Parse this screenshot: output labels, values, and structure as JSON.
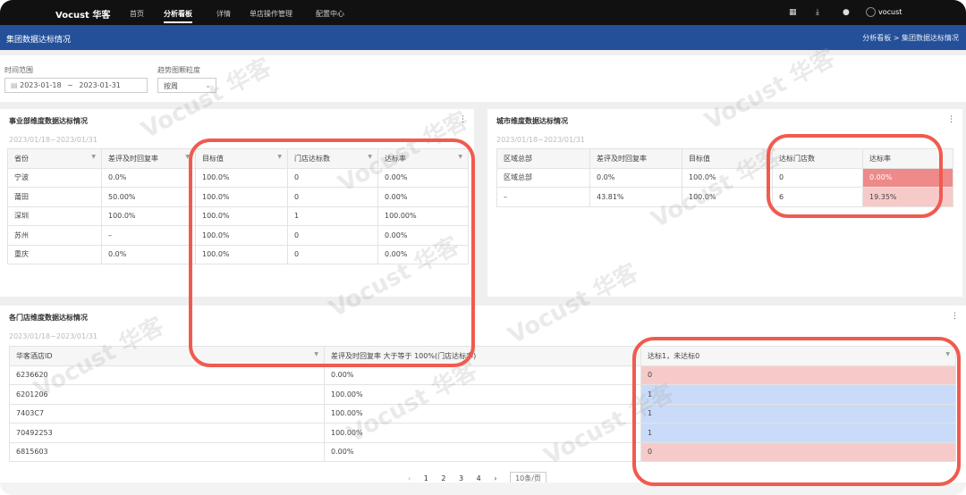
{
  "nav": {
    "brand": "Vocust 华客",
    "items": [
      "首页",
      "分析看板",
      "详情",
      "单店操作管理",
      "配置中心"
    ],
    "active": "分析看板",
    "user": "vocust",
    "icons": [
      "grid-icon",
      "download-icon",
      "help-icon"
    ]
  },
  "banner": {
    "title": "集团数据达标情况",
    "breadcrumb": "分析看板 > 集团数据达标情况"
  },
  "filters": {
    "time_label": "时间范围",
    "date_start": "2023-01-18",
    "date_sep": "~",
    "date_end": "2023-01-31",
    "granularity_label": "趋势图颗粒度",
    "granularity_value": "按周"
  },
  "card1": {
    "title": "事业部维度数据达标情况",
    "menu": "⋮",
    "date": "2023/01/18~2023/01/31",
    "headers": [
      "省份",
      "差评及时回复率",
      "目标值",
      "门店达标数",
      "达标率"
    ],
    "rows": [
      [
        "宁波",
        "0.0%",
        "100.0%",
        "0",
        "0.00%"
      ],
      [
        "莆田",
        "50.00%",
        "100.0%",
        "0",
        "0.00%"
      ],
      [
        "深圳",
        "100.0%",
        "100.0%",
        "1",
        "100.00%"
      ],
      [
        "苏州",
        "–",
        "100.0%",
        "0",
        "0.00%"
      ],
      [
        "重庆",
        "0.0%",
        "100.0%",
        "0",
        "0.00%"
      ]
    ]
  },
  "card2": {
    "title": "城市维度数据达标情况",
    "menu": "⋮",
    "date": "2023/01/18~2023/01/31",
    "headers": [
      "区域总部",
      "差评及时回复率",
      "目标值",
      "达标门店数",
      "达标率"
    ],
    "rows": [
      [
        "区域总部",
        "0.0%",
        "100.0%",
        "0",
        "0.00%"
      ],
      [
        "–",
        "43.81%",
        "100.0%",
        "6",
        "19.35%"
      ]
    ]
  },
  "card3": {
    "title": "各门店维度数据达标情况",
    "menu": "⋮",
    "date": "2023/01/18~2023/01/31",
    "headers": [
      "华客酒店ID",
      "差评及时回复率 大于等于 100%(门店达标率)",
      "达标1，未达标0"
    ],
    "rows": [
      [
        "6236620",
        "0.00%",
        "0"
      ],
      [
        "6201206",
        "100.00%",
        "1"
      ],
      [
        "7403C7",
        "100.00%",
        "1"
      ],
      [
        "70492253",
        "100.00%",
        "1"
      ],
      [
        "6815603",
        "0.00%",
        "0"
      ]
    ]
  },
  "pager": {
    "prev": "‹",
    "pages": [
      "1",
      "2",
      "3",
      "4"
    ],
    "next": "›",
    "page_size": "10条/页"
  },
  "watermark": "Vocust 华客",
  "colors": {
    "nav": "#111111",
    "banner": "#24509a",
    "highlight_ring": "#f05b4f",
    "not_met": "#f7caca",
    "met": "#c9dbf9"
  }
}
